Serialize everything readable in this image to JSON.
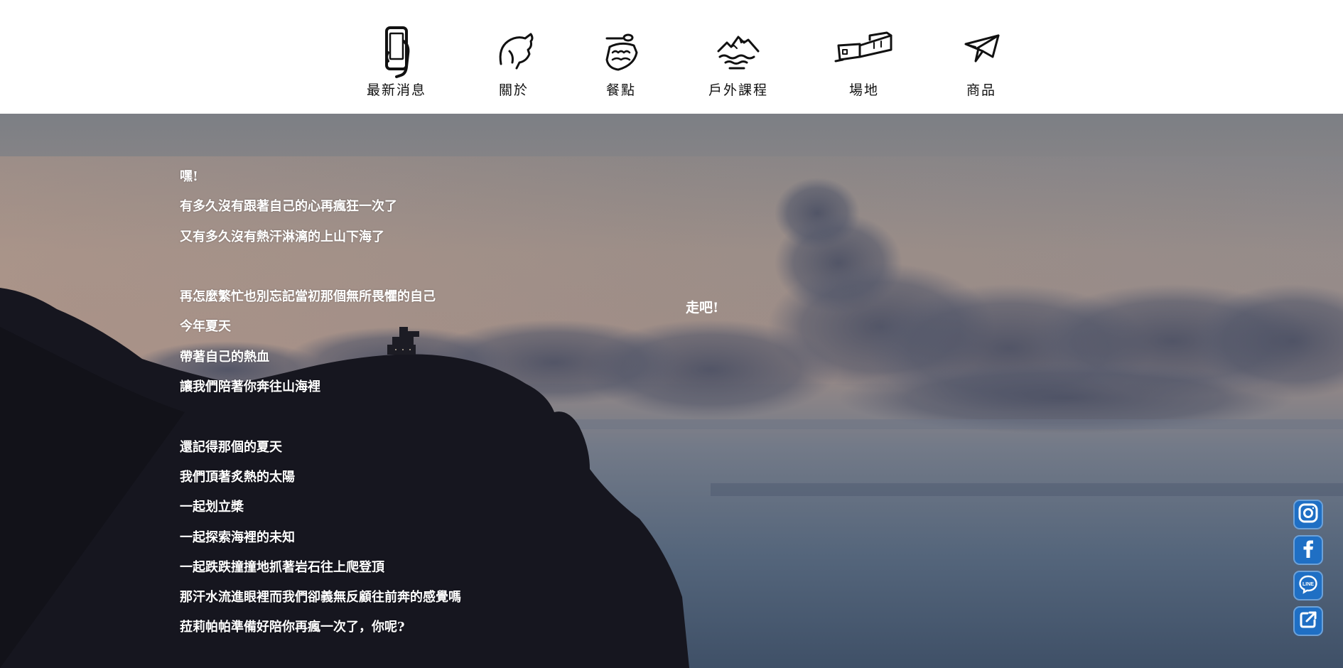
{
  "nav": {
    "items": [
      {
        "label": "最新消息",
        "icon": "smartphone-icon"
      },
      {
        "label": "關於",
        "icon": "profile-icon"
      },
      {
        "label": "餐點",
        "icon": "meal-icon"
      },
      {
        "label": "戶外課程",
        "icon": "mountain-icon"
      },
      {
        "label": "場地",
        "icon": "building-icon"
      },
      {
        "label": "商品",
        "icon": "paper-plane-icon"
      }
    ]
  },
  "hero": {
    "lines": [
      "嘿!",
      "有多久沒有跟著自己的心再瘋狂一次了",
      "又有多久沒有熱汗淋漓的上山下海了",
      "",
      "再怎麼繁忙也別忘記當初那個無所畏懼的自己",
      "今年夏天",
      "帶著自己的熱血",
      "讓我們陪著你奔往山海裡",
      "",
      "還記得那個的夏天",
      "我們頂著炙熱的太陽",
      "一起划立槳",
      "一起探索海裡的未知",
      "一起跌跌撞撞地抓著岩石往上爬登頂",
      "那汗水流進眼裡而我們卻義無反顧往前奔的感覺嗎",
      "菈莉帕帕準備好陪你再瘋一次了，你呢?"
    ],
    "callout": "走吧!"
  },
  "social": {
    "items": [
      {
        "icon": "instagram-icon"
      },
      {
        "icon": "facebook-icon"
      },
      {
        "icon": "line-icon",
        "label": "LINE"
      },
      {
        "icon": "share-icon"
      }
    ],
    "accent": "#1f6fc4"
  }
}
